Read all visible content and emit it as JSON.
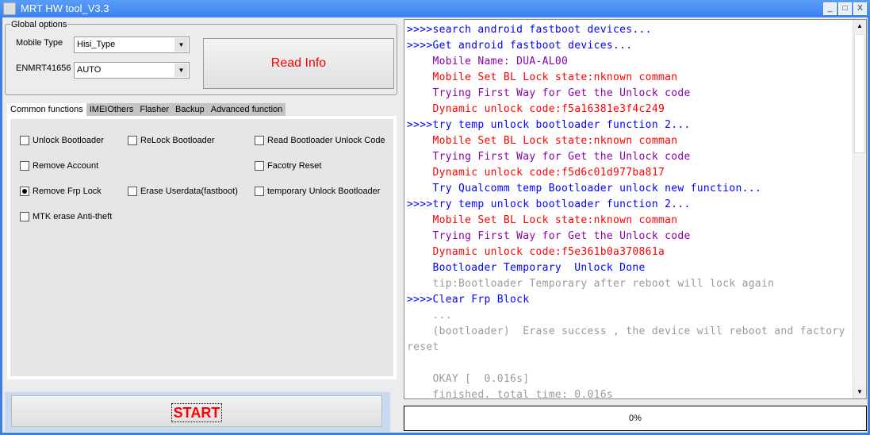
{
  "window": {
    "title": "MRT HW tool_V3.3",
    "min": "_",
    "max": "□",
    "close": "X"
  },
  "global": {
    "label": "Global options",
    "mobile_type_label": "Mobile Type",
    "mobile_type_value": "Hisi_Type",
    "en_label": "ENMRT41656",
    "en_value": "AUTO",
    "read_info": "Read Info"
  },
  "tabs": [
    "Common functions",
    "IMEIOthers",
    "Flasher",
    "Backup",
    "Advanced function"
  ],
  "options": [
    {
      "label": "Unlock Bootloader",
      "checked": false
    },
    {
      "label": "ReLock Bootloader",
      "checked": false
    },
    {
      "label": "Read Bootloader Unlock Code",
      "checked": false
    },
    {
      "label": "Remove Account",
      "checked": false
    },
    {
      "label": "Facotry Reset",
      "checked": false
    },
    {
      "label": "Remove Frp Lock",
      "checked": true
    },
    {
      "label": "Erase Userdata(fastboot)",
      "checked": false
    },
    {
      "label": "temporary Unlock Bootloader",
      "checked": false
    },
    {
      "label": "MTK erase Anti-theft",
      "checked": false
    }
  ],
  "start": "START",
  "colors": {
    "blue": "#0000ff",
    "purple": "#8b00a8",
    "red": "#ff0000",
    "gray": "#9a9a9a"
  },
  "log": [
    {
      "t": ">>>>search android fastboot devices...",
      "c": "blue"
    },
    {
      "t": ">>>>Get android fastboot devices...",
      "c": "blue"
    },
    {
      "t": "    Mobile Name: DUA-AL00",
      "c": "purple"
    },
    {
      "t": "    Mobile Set BL Lock state:nknown comman",
      "c": "red"
    },
    {
      "t": "    Trying First Way for Get the Unlock code",
      "c": "purple"
    },
    {
      "t": "    Dynamic unlock code:f5a16381e3f4c249",
      "c": "red"
    },
    {
      "t": ">>>>try temp unlock bootloader function 2...",
      "c": "blue"
    },
    {
      "t": "    Mobile Set BL Lock state:nknown comman",
      "c": "red"
    },
    {
      "t": "    Trying First Way for Get the Unlock code",
      "c": "purple"
    },
    {
      "t": "    Dynamic unlock code:f5d6c01d977ba817",
      "c": "red"
    },
    {
      "t": "    Try Qualcomm temp Bootloader unlock new function...",
      "c": "blue"
    },
    {
      "t": ">>>>try temp unlock bootloader function 2...",
      "c": "blue"
    },
    {
      "t": "    Mobile Set BL Lock state:nknown comman",
      "c": "red"
    },
    {
      "t": "    Trying First Way for Get the Unlock code",
      "c": "purple"
    },
    {
      "t": "    Dynamic unlock code:f5e361b0a370861a",
      "c": "red"
    },
    {
      "t": "    Bootloader Temporary  Unlock Done",
      "c": "blue"
    },
    {
      "t": "    tip:Bootloader Temporary after reboot will lock again",
      "c": "gray"
    },
    {
      "t": ">>>>Clear Frp Block",
      "c": "blue"
    },
    {
      "t": "    ...",
      "c": "gray"
    },
    {
      "t": "    (bootloader)  Erase success , the device will reboot and factory",
      "c": "gray"
    },
    {
      "t": "reset",
      "c": "gray"
    },
    {
      "t": "",
      "c": "gray"
    },
    {
      "t": "    OKAY [  0.016s]",
      "c": "gray"
    },
    {
      "t": "    finished. total time: 0.016s",
      "c": "gray"
    }
  ],
  "progress": {
    "value": 0,
    "label": "0%"
  }
}
